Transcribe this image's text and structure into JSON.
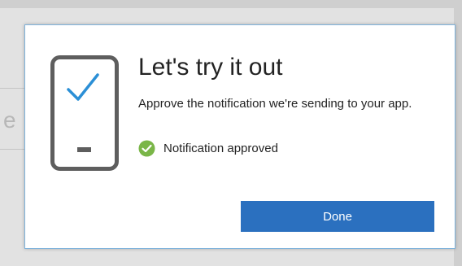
{
  "dialog": {
    "title": "Let's try it out",
    "description": "Approve the notification we're sending to your app.",
    "status": {
      "text": "Notification approved",
      "icon": "check-circle-icon",
      "color": "#7ab648"
    },
    "done_button": {
      "label": "Done",
      "color": "#2b70bf"
    },
    "phone_icon": "phone-check-icon",
    "accent_color": "#2b8fd6"
  },
  "background": {
    "partial_letter": "e"
  }
}
